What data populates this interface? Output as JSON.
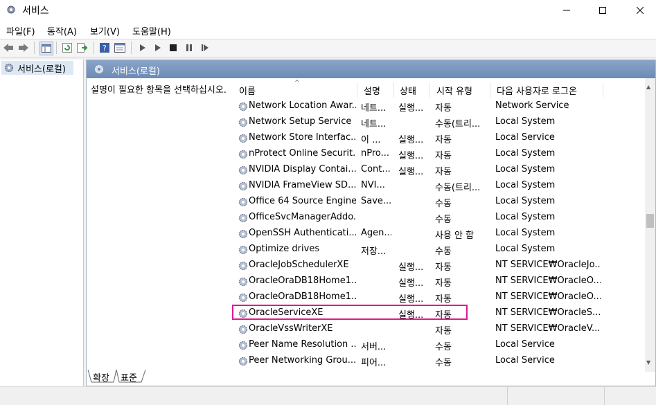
{
  "window": {
    "title": "서비스"
  },
  "menu": [
    "파일(F)",
    "동작(A)",
    "보기(V)",
    "도움말(H)"
  ],
  "tree": {
    "item": "서비스(로컬)"
  },
  "pane": {
    "header": "서비스(로컬)",
    "description": "설명이 필요한 항목을 선택하십시오."
  },
  "columns": [
    "이름",
    "설명",
    "상태",
    "시작 유형",
    "다음 사용자로 로그온"
  ],
  "rows": [
    {
      "name": "Network Location Awar...",
      "desc": "네트...",
      "status": "실행...",
      "startup": "자동",
      "logon": "Network Service"
    },
    {
      "name": "Network Setup Service",
      "desc": "네트...",
      "status": "",
      "startup": "수동(트리...",
      "logon": "Local System"
    },
    {
      "name": "Network Store Interfac...",
      "desc": "이 ...",
      "status": "실행...",
      "startup": "자동",
      "logon": "Local Service"
    },
    {
      "name": "nProtect Online Securit...",
      "desc": "nPro...",
      "status": "실행...",
      "startup": "자동",
      "logon": "Local System"
    },
    {
      "name": "NVIDIA Display Contai...",
      "desc": "Cont...",
      "status": "실행...",
      "startup": "자동",
      "logon": "Local System"
    },
    {
      "name": "NVIDIA FrameView SD...",
      "desc": "NVI...",
      "status": "",
      "startup": "수동(트리...",
      "logon": "Local System"
    },
    {
      "name": "Office 64 Source Engine",
      "desc": "Save...",
      "status": "",
      "startup": "수동",
      "logon": "Local System"
    },
    {
      "name": "OfficeSvcManagerAddo...",
      "desc": "",
      "status": "",
      "startup": "수동",
      "logon": "Local System"
    },
    {
      "name": "OpenSSH Authenticati...",
      "desc": "Agen...",
      "status": "",
      "startup": "사용 안 함",
      "logon": "Local System"
    },
    {
      "name": "Optimize drives",
      "desc": "저장...",
      "status": "",
      "startup": "수동",
      "logon": "Local System"
    },
    {
      "name": "OracleJobSchedulerXE",
      "desc": "",
      "status": "실행...",
      "startup": "자동",
      "logon": "NT SERVICE₩OracleJo..."
    },
    {
      "name": "OracleOraDB18Home1...",
      "desc": "",
      "status": "실행...",
      "startup": "자동",
      "logon": "NT SERVICE₩OracleO..."
    },
    {
      "name": "OracleOraDB18Home1...",
      "desc": "",
      "status": "실행...",
      "startup": "자동",
      "logon": "NT SERVICE₩OracleO..."
    },
    {
      "name": "OracleServiceXE",
      "desc": "",
      "status": "실행...",
      "startup": "자동",
      "logon": "NT SERVICE₩OracleS..."
    },
    {
      "name": "OracleVssWriterXE",
      "desc": "",
      "status": "",
      "startup": "자동",
      "logon": "NT SERVICE₩OracleV..."
    },
    {
      "name": "Peer Name Resolution ...",
      "desc": "서버...",
      "status": "",
      "startup": "수동",
      "logon": "Local Service"
    },
    {
      "name": "Peer Networking Grou...",
      "desc": "피어...",
      "status": "",
      "startup": "수동",
      "logon": "Local Service"
    }
  ],
  "tabs": [
    "확장",
    "표준"
  ],
  "colors": {
    "highlight": "#e0188c",
    "header_bg": "#7b97bf"
  }
}
